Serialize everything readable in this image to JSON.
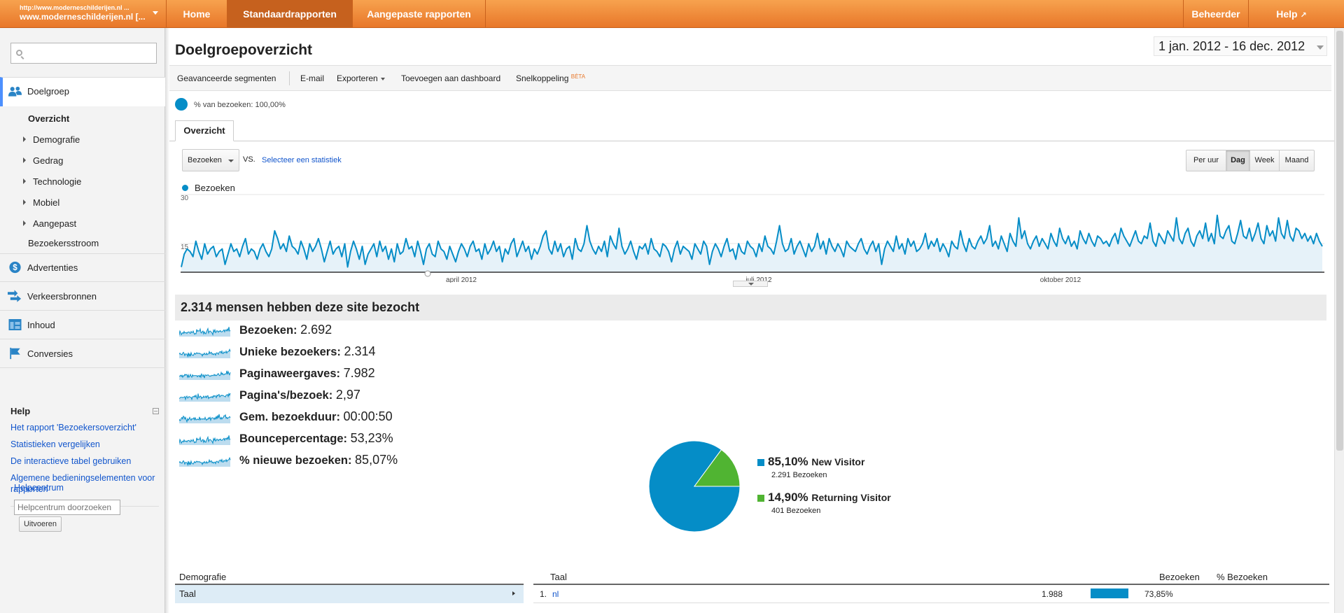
{
  "topbar": {
    "account_url": "http://www.moderneschilderijen.nl ...",
    "account_name": "www.moderneschilderijen.nl [...",
    "tabs": [
      "Home",
      "Standaardrapporten",
      "Aangepaste rapporten"
    ],
    "admin": "Beheerder",
    "help": "Help"
  },
  "sidebar": {
    "sections": [
      {
        "label": "Doelgroep",
        "icon": "audience-icon"
      },
      {
        "label": "Advertenties",
        "icon": "dollar-icon"
      },
      {
        "label": "Verkeersbronnen",
        "icon": "traffic-arrow-icon"
      },
      {
        "label": "Inhoud",
        "icon": "content-icon"
      },
      {
        "label": "Conversies",
        "icon": "flag-icon"
      }
    ],
    "subitems": [
      "Overzicht",
      "Demografie",
      "Gedrag",
      "Technologie",
      "Mobiel",
      "Aangepast",
      "Bezoekersstroom"
    ],
    "help": {
      "title": "Help",
      "links": [
        "Het rapport 'Bezoekersoverzicht'",
        "Statistieken vergelijken",
        "De interactieve tabel gebruiken",
        "Algemene bedieningselementen voor rapporten"
      ],
      "center": "Helpcentrum",
      "search_placeholder": "Helpcentrum doorzoeken",
      "go": "Uitvoeren"
    }
  },
  "main": {
    "title": "Doelgroepoverzicht",
    "date_range": "1 jan. 2012 - 16 dec. 2012",
    "toolbar": [
      "Geavanceerde segmenten",
      "E-mail",
      "Exporteren",
      "Toevoegen aan dashboard",
      "Snelkoppeling"
    ],
    "beta": "BÈTA",
    "segment": "% van bezoeken: 100,00%",
    "tab": "Overzicht",
    "metric_select": "Bezoeken",
    "vs": "VS.",
    "select_stat": "Selecteer een statistiek",
    "granularity": [
      "Per uur",
      "Dag",
      "Week",
      "Maand"
    ],
    "granularity_selected": "Dag",
    "summary": "2.314 mensen hebben deze site bezocht",
    "metrics": [
      {
        "label": "Bezoeken:",
        "value": "2.692"
      },
      {
        "label": "Unieke bezoekers:",
        "value": "2.314"
      },
      {
        "label": "Paginaweergaves:",
        "value": "7.982"
      },
      {
        "label": "Pagina's/bezoek:",
        "value": "2,97"
      },
      {
        "label": "Gem. bezoekduur:",
        "value": "00:00:50"
      },
      {
        "label": "Bouncepercentage:",
        "value": "53,23%"
      },
      {
        "label": "% nieuwe bezoeken:",
        "value": "85,07%"
      }
    ],
    "pie_legend": [
      {
        "pct": "85,10%",
        "name": "New Visitor",
        "sub": "2.291 Bezoeken",
        "color": "#058dc7"
      },
      {
        "pct": "14,90%",
        "name": "Returning Visitor",
        "sub": "401 Bezoeken",
        "color": "#50b432"
      }
    ],
    "demographics": {
      "title": "Demografie",
      "row": "Taal"
    },
    "language_table": {
      "headers": [
        "Taal",
        "Bezoeken",
        "% Bezoeken"
      ],
      "rows": [
        {
          "rank": "1.",
          "lang": "nl",
          "visits": "1.988",
          "pct": "73,85%",
          "fraction": 0.7385
        }
      ]
    }
  },
  "chart_data": [
    {
      "type": "area",
      "series": [
        {
          "name": "Bezoeken"
        }
      ],
      "y_ticks": [
        "30",
        "15"
      ],
      "ylim": [
        0,
        30
      ],
      "x_labels": [
        "april 2012",
        "juli 2012",
        "oktober 2012"
      ],
      "x_range": [
        "2012-01-01",
        "2012-12-16"
      ],
      "color": "#058dc7",
      "values": [
        2,
        7,
        9,
        8,
        6,
        12,
        8,
        5,
        11,
        7,
        9,
        10,
        6,
        8,
        9,
        3,
        7,
        11,
        8,
        9,
        6,
        10,
        13,
        7,
        9,
        8,
        5,
        9,
        11,
        8,
        6,
        9,
        16,
        13,
        9,
        11,
        8,
        14,
        10,
        9,
        7,
        12,
        9,
        5,
        11,
        8,
        10,
        13,
        9,
        4,
        8,
        12,
        7,
        9,
        10,
        6,
        11,
        2,
        8,
        12,
        9,
        5,
        10,
        3,
        7,
        9,
        11,
        6,
        12,
        8,
        10,
        5,
        9,
        4,
        11,
        7,
        8,
        13,
        9,
        10,
        6,
        12,
        8,
        3,
        9,
        11,
        7,
        6,
        12,
        9,
        8,
        5,
        10,
        7,
        4,
        8,
        11,
        9,
        6,
        10,
        12,
        8,
        9,
        5,
        11,
        7,
        9,
        12,
        8,
        10,
        4,
        9,
        7,
        11,
        13,
        6,
        9,
        12,
        8,
        10,
        5,
        9,
        7,
        10,
        14,
        16,
        9,
        7,
        12,
        8,
        11,
        6,
        9,
        10,
        5,
        13,
        9,
        8,
        11,
        18,
        12,
        9,
        7,
        10,
        8,
        12,
        6,
        14,
        11,
        9,
        17,
        10,
        7,
        9,
        12,
        8,
        5,
        10,
        9,
        11,
        7,
        13,
        9,
        8,
        6,
        11,
        10,
        8,
        4,
        9,
        12,
        7,
        10,
        9,
        8,
        5,
        11,
        9,
        7,
        12,
        10,
        3,
        8,
        11,
        9,
        6,
        10,
        13,
        8,
        9,
        5,
        11,
        8,
        7,
        12,
        10,
        9,
        6,
        11,
        8,
        14,
        10,
        9,
        7,
        12,
        18,
        11,
        8,
        9,
        13,
        7,
        10,
        12,
        9,
        6,
        11,
        8,
        10,
        15,
        9,
        12,
        7,
        13,
        10,
        8,
        11,
        9,
        6,
        12,
        10,
        9,
        8,
        11,
        13,
        9,
        7,
        10,
        12,
        8,
        11,
        3,
        9,
        12,
        10,
        8,
        14,
        9,
        11,
        7,
        13,
        10,
        12,
        8,
        9,
        11,
        15,
        9,
        12,
        10,
        13,
        8,
        11,
        9,
        6,
        12,
        10,
        9,
        16,
        11,
        8,
        13,
        10,
        9,
        12,
        14,
        11,
        13,
        18,
        10,
        12,
        9,
        14,
        11,
        8,
        15,
        12,
        10,
        21,
        13,
        16,
        11,
        9,
        12,
        14,
        10,
        13,
        11,
        9,
        15,
        12,
        10,
        17,
        13,
        11,
        14,
        10,
        12,
        9,
        16,
        13,
        11,
        15,
        12,
        10,
        14,
        13,
        11,
        12,
        10,
        13,
        15,
        11,
        17,
        14,
        12,
        10,
        13,
        16,
        12,
        11,
        14,
        13,
        19,
        12,
        10,
        15,
        13,
        11,
        16,
        14,
        12,
        21,
        13,
        11,
        15,
        17,
        12,
        10,
        14,
        16,
        13,
        19,
        12,
        15,
        11,
        22,
        14,
        13,
        16,
        18,
        12,
        11,
        15,
        20,
        14,
        13,
        17,
        12,
        15,
        19,
        13,
        11,
        18,
        14,
        16,
        12,
        21,
        15,
        13,
        20,
        14,
        12,
        17,
        16,
        13,
        15,
        12,
        14,
        11,
        15,
        12,
        10
      ]
    },
    {
      "type": "pie",
      "categories": [
        "New Visitor",
        "Returning Visitor"
      ],
      "values": [
        85.1,
        14.9
      ],
      "colors": [
        "#058dc7",
        "#50b432"
      ]
    }
  ]
}
